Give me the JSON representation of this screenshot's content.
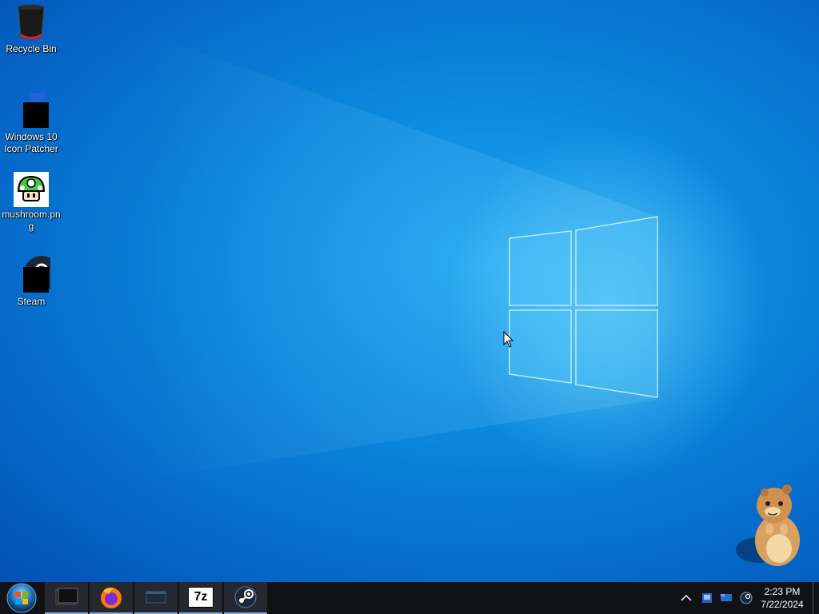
{
  "desktop": {
    "icons": [
      {
        "label": "Recycle Bin",
        "icon": "recycle-bin-icon"
      },
      {
        "label": "Windows 10 Icon Patcher",
        "icon": "windows-10-icon-patcher-icon"
      },
      {
        "label": "mushroom.png",
        "icon": "mushroom-image-icon"
      },
      {
        "label": "Steam",
        "icon": "steam-icon"
      }
    ]
  },
  "taskbar": {
    "start_icon": "windows-start-orb-icon",
    "pinned": [
      {
        "name": "terminal",
        "icon": "terminal-icon"
      },
      {
        "name": "firefox",
        "icon": "firefox-icon"
      },
      {
        "name": "app",
        "icon": "app-window-icon"
      },
      {
        "name": "7-zip",
        "icon": "7zip-icon",
        "text": "7z"
      },
      {
        "name": "steam",
        "icon": "steam-icon"
      }
    ],
    "tray": {
      "chevron": "^",
      "time": "2:23 PM",
      "date": "7/22/2024"
    }
  },
  "colors": {
    "desktop_blue": "#0a86dc",
    "taskbar": "#101216"
  }
}
